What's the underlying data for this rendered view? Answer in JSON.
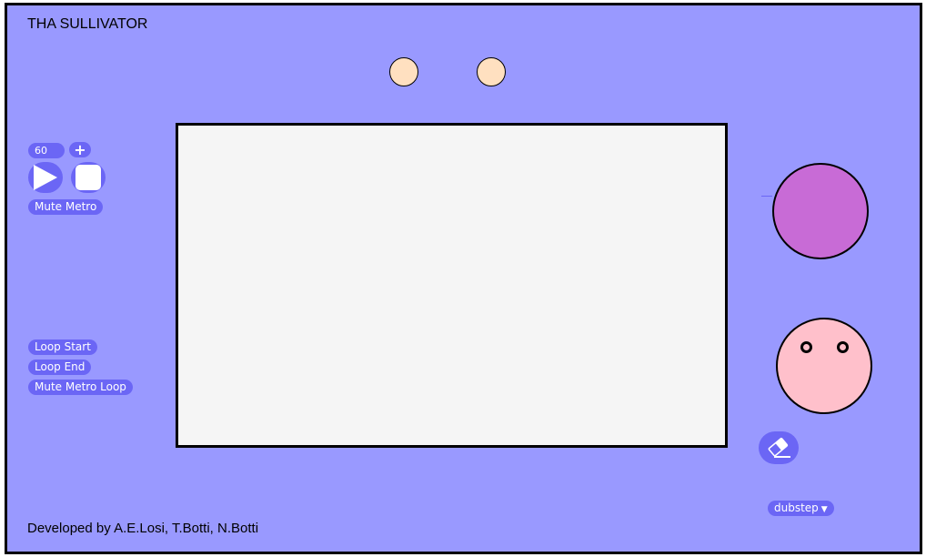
{
  "app": {
    "title": "THA SULLIVATOR",
    "footer": "Developed by A.E.Losi, T.Botti, N.Botti"
  },
  "transport": {
    "bpm": "60",
    "plus_label": "+",
    "play_icon": "play-icon",
    "stop_icon": "stop-icon",
    "mute_metro_label": "Mute Metro"
  },
  "loop": {
    "start_label": "Loop Start",
    "end_label": "Loop End",
    "mute_loop_label": "Mute Metro Loop"
  },
  "tools": {
    "eraser_icon": "eraser-icon",
    "genre_selected": "dubstep",
    "genre_arrow": "▼"
  },
  "colors": {
    "background": "#9999ff",
    "button": "#6b66f5",
    "canvas": "#f5f5f5",
    "eyes": "#ffe0c0",
    "purple_knob": "#c86bd6",
    "face": "#ffc0cb"
  }
}
